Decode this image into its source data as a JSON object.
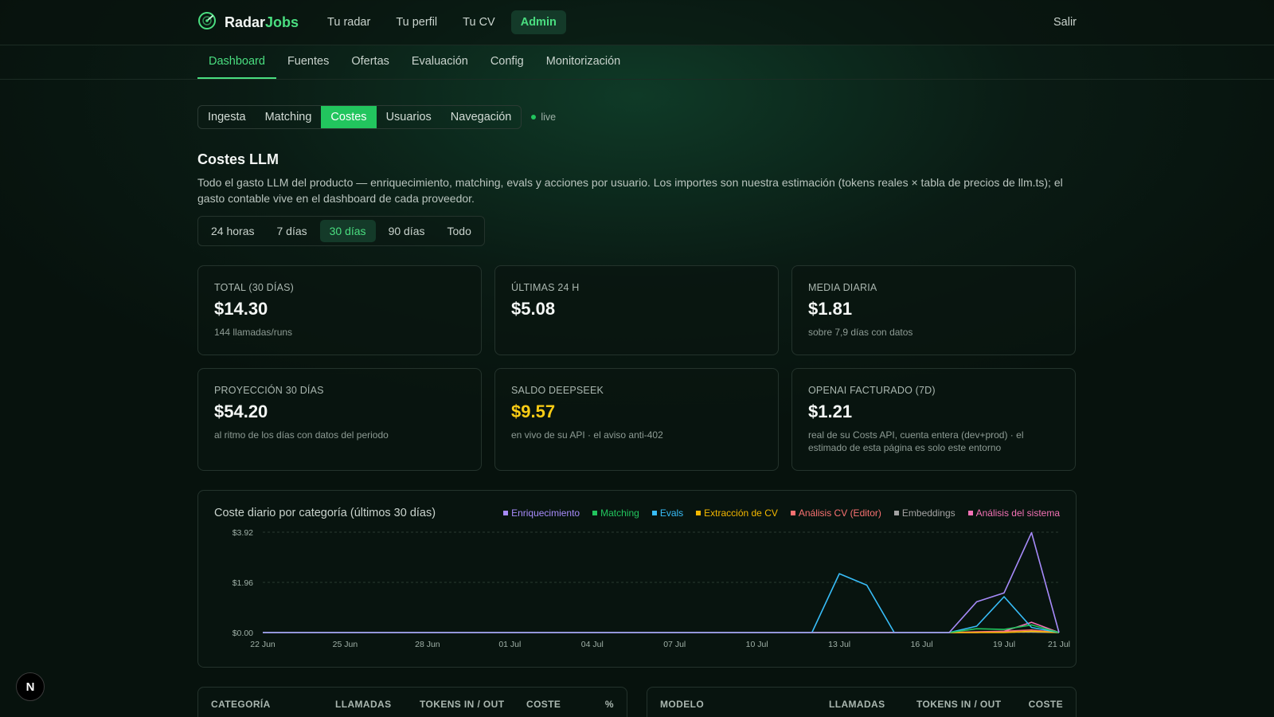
{
  "brand": {
    "name_a": "Radar",
    "name_b": "Jobs",
    "icon": "radar-logo-icon"
  },
  "topnav": {
    "items": [
      {
        "label": "Tu radar"
      },
      {
        "label": "Tu perfil"
      },
      {
        "label": "Tu CV"
      },
      {
        "label": "Admin",
        "active": true
      }
    ],
    "logout": "Salir"
  },
  "subnav": {
    "items": [
      {
        "label": "Dashboard",
        "active": true
      },
      {
        "label": "Fuentes"
      },
      {
        "label": "Ofertas"
      },
      {
        "label": "Evaluación"
      },
      {
        "label": "Config"
      },
      {
        "label": "Monitorización"
      }
    ]
  },
  "section_tabs": {
    "items": [
      {
        "label": "Ingesta"
      },
      {
        "label": "Matching"
      },
      {
        "label": "Costes",
        "active": true
      },
      {
        "label": "Usuarios"
      },
      {
        "label": "Navegación"
      }
    ],
    "live_label": "live"
  },
  "page": {
    "title": "Costes LLM",
    "description": "Todo el gasto LLM del producto — enriquecimiento, matching, evals y acciones por usuario. Los importes son nuestra estimación (tokens reales × tabla de precios de llm.ts); el gasto contable vive en el dashboard de cada proveedor."
  },
  "range": {
    "items": [
      {
        "label": "24 horas"
      },
      {
        "label": "7 días"
      },
      {
        "label": "30 días",
        "active": true
      },
      {
        "label": "90 días"
      },
      {
        "label": "Todo"
      }
    ]
  },
  "cards": [
    {
      "label": "TOTAL (30 DÍAS)",
      "value": "$14.30",
      "sub": "144 llamadas/runs"
    },
    {
      "label": "ÚLTIMAS 24 H",
      "value": "$5.08",
      "sub": ""
    },
    {
      "label": "MEDIA DIARIA",
      "value": "$1.81",
      "sub": "sobre 7,9 días con datos"
    },
    {
      "label": "PROYECCIÓN 30 DÍAS",
      "value": "$54.20",
      "sub": "al ritmo de los días con datos del periodo"
    },
    {
      "label": "SALDO DEEPSEEK",
      "value": "$9.57",
      "sub": "en vivo de su API · el aviso anti-402",
      "highlight": true
    },
    {
      "label": "OPENAI FACTURADO (7D)",
      "value": "$1.21",
      "sub": "real de su Costs API, cuenta entera (dev+prod) · el estimado de esta página es solo este entorno"
    }
  ],
  "chart": {
    "title": "Coste diario por categoría (últimos 30 días)",
    "legend": [
      {
        "name": "Enriquecimiento",
        "color": "#a78bfa"
      },
      {
        "name": "Matching",
        "color": "#22c55e"
      },
      {
        "name": "Evals",
        "color": "#38bdf8"
      },
      {
        "name": "Extracción de CV",
        "color": "#f5b800"
      },
      {
        "name": "Análisis CV (Editor)",
        "color": "#f87171"
      },
      {
        "name": "Embeddings",
        "color": "#a3a3a3"
      },
      {
        "name": "Análisis del sistema",
        "color": "#f472b6"
      }
    ]
  },
  "chart_data": {
    "type": "line",
    "title": "Coste diario por categoría (últimos 30 días)",
    "x": [
      "22 Jun",
      "23 Jun",
      "24 Jun",
      "25 Jun",
      "26 Jun",
      "27 Jun",
      "28 Jun",
      "29 Jun",
      "30 Jun",
      "01 Jul",
      "02 Jul",
      "03 Jul",
      "04 Jul",
      "05 Jul",
      "06 Jul",
      "07 Jul",
      "08 Jul",
      "09 Jul",
      "10 Jul",
      "11 Jul",
      "12 Jul",
      "13 Jul",
      "14 Jul",
      "15 Jul",
      "16 Jul",
      "17 Jul",
      "18 Jul",
      "19 Jul",
      "20 Jul",
      "21 Jul"
    ],
    "x_tick_labels": [
      "22 Jun",
      "25 Jun",
      "28 Jun",
      "01 Jul",
      "04 Jul",
      "07 Jul",
      "10 Jul",
      "13 Jul",
      "16 Jul",
      "19 Jul",
      "21 Jul"
    ],
    "y_tick_labels": [
      "$0.00",
      "$1.96",
      "$3.92"
    ],
    "ylim": [
      0,
      3.92
    ],
    "grid": true,
    "legend_position": "top-right",
    "series": [
      {
        "name": "Enriquecimiento",
        "values": [
          0,
          0,
          0,
          0,
          0,
          0,
          0,
          0,
          0,
          0,
          0,
          0,
          0,
          0,
          0,
          0,
          0,
          0,
          0,
          0,
          0,
          0,
          0,
          0,
          0,
          0,
          1.2,
          1.55,
          3.9,
          0
        ]
      },
      {
        "name": "Matching",
        "values": [
          0,
          0,
          0,
          0,
          0,
          0,
          0,
          0,
          0,
          0,
          0,
          0,
          0,
          0,
          0,
          0,
          0,
          0,
          0,
          0,
          0,
          0,
          0,
          0,
          0,
          0,
          0.15,
          0.12,
          0.3,
          0
        ]
      },
      {
        "name": "Evals",
        "values": [
          0,
          0,
          0,
          0,
          0,
          0,
          0,
          0,
          0,
          0,
          0,
          0,
          0,
          0,
          0,
          0,
          0,
          0,
          0,
          0,
          0,
          2.3,
          1.85,
          0,
          0,
          0,
          0.25,
          1.4,
          0.2,
          0
        ]
      },
      {
        "name": "Extracción de CV",
        "values": [
          0,
          0,
          0,
          0,
          0,
          0,
          0,
          0,
          0,
          0,
          0,
          0,
          0,
          0,
          0,
          0,
          0,
          0,
          0,
          0,
          0,
          0,
          0,
          0,
          0,
          0,
          0,
          0,
          0.05,
          0
        ]
      },
      {
        "name": "Análisis CV (Editor)",
        "values": [
          0,
          0,
          0,
          0,
          0,
          0,
          0,
          0,
          0,
          0,
          0,
          0,
          0,
          0,
          0,
          0,
          0,
          0,
          0,
          0,
          0,
          0,
          0,
          0,
          0,
          0,
          0.03,
          0.05,
          0.1,
          0
        ]
      },
      {
        "name": "Embeddings",
        "values": [
          0,
          0,
          0,
          0,
          0,
          0,
          0,
          0,
          0,
          0,
          0,
          0,
          0,
          0,
          0,
          0,
          0,
          0,
          0,
          0,
          0,
          0,
          0,
          0,
          0,
          0,
          0.02,
          0.02,
          0.02,
          0
        ]
      },
      {
        "name": "Análisis del sistema",
        "values": [
          0,
          0,
          0,
          0,
          0,
          0,
          0,
          0,
          0,
          0,
          0,
          0,
          0,
          0,
          0,
          0,
          0,
          0,
          0,
          0,
          0,
          0,
          0,
          0,
          0,
          0,
          0,
          0.05,
          0.4,
          0
        ]
      }
    ]
  },
  "tables": {
    "left": {
      "headers": [
        "CATEGORÍA",
        "LLAMADAS",
        "TOKENS IN / OUT",
        "COSTE",
        "%"
      ]
    },
    "right": {
      "headers": [
        "MODELO",
        "LLAMADAS",
        "TOKENS IN / OUT",
        "COSTE"
      ]
    }
  },
  "badge": {
    "label": "N",
    "icon": "nextjs-icon"
  }
}
